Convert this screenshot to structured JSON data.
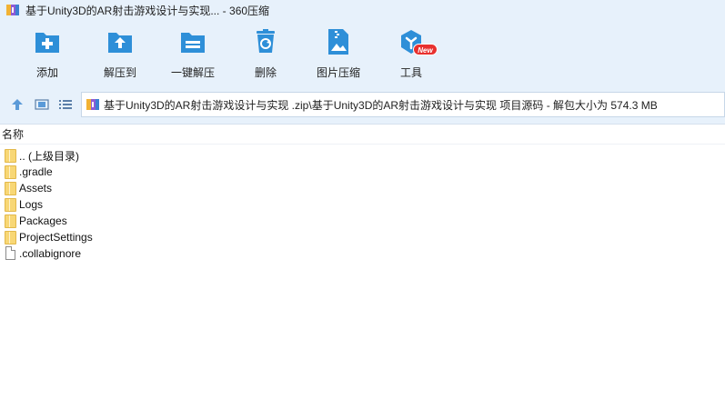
{
  "window": {
    "title": "基于Unity3D的AR射击游戏设计与实现... - 360压缩"
  },
  "toolbar": {
    "items": [
      {
        "label": "添加",
        "icon": "add-icon"
      },
      {
        "label": "解压到",
        "icon": "extract-to-icon"
      },
      {
        "label": "一键解压",
        "icon": "one-click-extract-icon"
      },
      {
        "label": "删除",
        "icon": "recycle-bin-icon"
      },
      {
        "label": "图片压缩",
        "icon": "image-compress-icon"
      },
      {
        "label": "工具",
        "icon": "tools-icon"
      }
    ],
    "new_badge": "New"
  },
  "address": {
    "path": "基于Unity3D的AR射击游戏设计与实现 .zip\\基于Unity3D的AR射击游戏设计与实现 项目源码 - 解包大小为 574.3 MB"
  },
  "list": {
    "column_name": "名称",
    "items": [
      {
        "name": ".. (上级目录)",
        "type": "folder"
      },
      {
        "name": ".gradle",
        "type": "folder"
      },
      {
        "name": "Assets",
        "type": "folder"
      },
      {
        "name": "Logs",
        "type": "folder"
      },
      {
        "name": "Packages",
        "type": "folder"
      },
      {
        "name": "ProjectSettings",
        "type": "folder"
      },
      {
        "name": ".collabignore",
        "type": "file"
      }
    ]
  },
  "colors": {
    "accent": "#2e8fd8",
    "background": "#e7f1fb",
    "badge": "#e8312f",
    "folder": "#f8d775"
  }
}
